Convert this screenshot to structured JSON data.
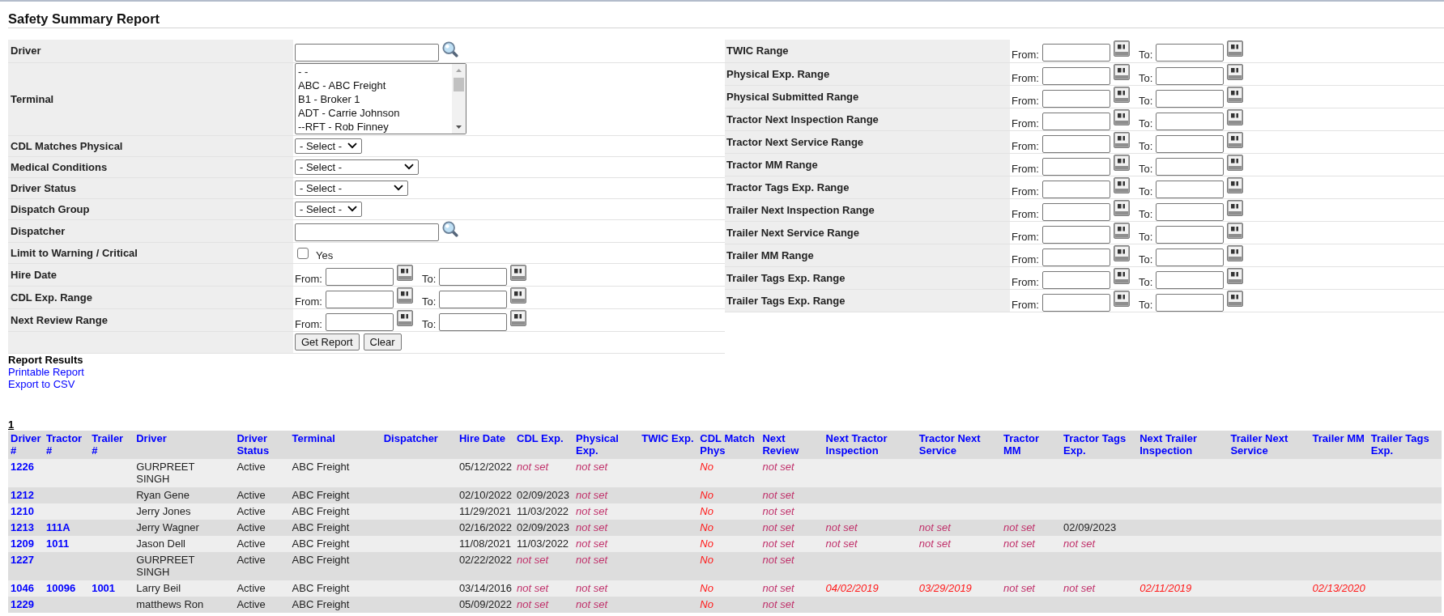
{
  "page": {
    "title": "Safety Summary Report"
  },
  "filters": [
    {
      "kind": "search",
      "label": "Driver"
    },
    {
      "kind": "listbox",
      "label": "Terminal",
      "options": [
        {
          "text": "- -",
          "selected": false
        },
        {
          "text": "ABC - ABC Freight",
          "selected": false
        },
        {
          "text": "B1 - Broker 1",
          "selected": false
        },
        {
          "text": "ADT - Carrie Johnson",
          "selected": false
        },
        {
          "text": "--RFT - Rob Finney",
          "selected": false
        }
      ]
    },
    {
      "kind": "select",
      "label": "CDL Matches Physical",
      "value": "- Select -"
    },
    {
      "kind": "select",
      "label": "Medical Conditions",
      "value": "- Select -"
    },
    {
      "kind": "select",
      "label": "Driver Status",
      "value": "- Select -"
    },
    {
      "kind": "select",
      "label": "Dispatch Group",
      "value": "- Select -"
    },
    {
      "kind": "search",
      "label": "Dispatcher"
    },
    {
      "kind": "checkbox",
      "label": "Limit to Warning / Critical",
      "option": "Yes",
      "checked": false
    },
    {
      "kind": "range",
      "label": "Hire Date",
      "from_label": "From:",
      "to_label": "To:"
    },
    {
      "kind": "range",
      "label": "CDL Exp. Range",
      "from_label": "From:",
      "to_label": "To:"
    },
    {
      "kind": "range",
      "label": "Next Review Range",
      "from_label": "From:",
      "to_label": "To:"
    },
    {
      "kind": "buttons",
      "buttons": [
        "Get Report",
        "Clear"
      ]
    }
  ],
  "range_filters": [
    {
      "label": "TWIC Range",
      "from_label": "From:",
      "to_label": "To:"
    },
    {
      "label": "Physical Exp. Range",
      "from_label": "From:",
      "to_label": "To:"
    },
    {
      "label": "Physical Submitted Range",
      "from_label": "From:",
      "to_label": "To:"
    },
    {
      "label": "Tractor Next Inspection Range",
      "from_label": "From:",
      "to_label": "To:"
    },
    {
      "label": "Tractor Next Service Range",
      "from_label": "From:",
      "to_label": "To:"
    },
    {
      "label": "Tractor MM Range",
      "from_label": "From:",
      "to_label": "To:"
    },
    {
      "label": "Tractor Tags Exp. Range",
      "from_label": "From:",
      "to_label": "To:"
    },
    {
      "label": "Trailer Next Inspection Range",
      "from_label": "From:",
      "to_label": "To:"
    },
    {
      "label": "Trailer Next Service Range",
      "from_label": "From:",
      "to_label": "To:"
    },
    {
      "label": "Trailer MM Range",
      "from_label": "From:",
      "to_label": "To:"
    },
    {
      "label": "Trailer Tags Exp. Range",
      "from_label": "From:",
      "to_label": "To:"
    },
    {
      "label": "Trailer Tags Exp. Range",
      "from_label": "From:",
      "to_label": "To:"
    }
  ],
  "report_results": {
    "heading": "Report Results",
    "links": [
      "Printable Report",
      "Export to CSV"
    ]
  },
  "page_links": [
    "1"
  ],
  "table": {
    "columns": [
      "Driver #",
      "Tractor #",
      "Trailer #",
      "Driver",
      "Driver Status",
      "Terminal",
      "Dispatcher",
      "Hire Date",
      "CDL Exp.",
      "Physical Exp.",
      "TWIC Exp.",
      "CDL Match Phys",
      "Next Review",
      "Next Tractor Inspection",
      "Tractor Next Service",
      "Tractor MM",
      "Tractor Tags Exp.",
      "Next Trailer Inspection",
      "Trailer Next Service",
      "Trailer MM",
      "Trailer Tags Exp."
    ],
    "rows": [
      {
        "cells": [
          {
            "text": "1226",
            "kind": "link"
          },
          null,
          null,
          {
            "text": "GURPREET SINGH",
            "kind": "text"
          },
          {
            "text": "Active",
            "kind": "text"
          },
          {
            "text": "ABC Freight",
            "kind": "text"
          },
          null,
          {
            "text": "05/12/2022",
            "kind": "text"
          },
          {
            "text": "not set",
            "kind": "unset"
          },
          {
            "text": "not set",
            "kind": "unset"
          },
          null,
          {
            "text": "No",
            "kind": "alert"
          },
          {
            "text": "not set",
            "kind": "unset"
          }
        ]
      },
      {
        "cells": [
          {
            "text": "1212",
            "kind": "link"
          },
          null,
          null,
          {
            "text": "Ryan Gene",
            "kind": "text"
          },
          {
            "text": "Active",
            "kind": "text"
          },
          {
            "text": "ABC Freight",
            "kind": "text"
          },
          null,
          {
            "text": "02/10/2022",
            "kind": "text"
          },
          {
            "text": "02/09/2023",
            "kind": "text"
          },
          {
            "text": "not set",
            "kind": "unset"
          },
          null,
          {
            "text": "No",
            "kind": "alert"
          },
          {
            "text": "not set",
            "kind": "unset"
          }
        ]
      },
      {
        "cells": [
          {
            "text": "1210",
            "kind": "link"
          },
          null,
          null,
          {
            "text": "Jerry Jones",
            "kind": "text"
          },
          {
            "text": "Active",
            "kind": "text"
          },
          {
            "text": "ABC Freight",
            "kind": "text"
          },
          null,
          {
            "text": "11/29/2021",
            "kind": "text"
          },
          {
            "text": "11/03/2022",
            "kind": "text"
          },
          {
            "text": "not set",
            "kind": "unset"
          },
          null,
          {
            "text": "No",
            "kind": "alert"
          },
          {
            "text": "not set",
            "kind": "unset"
          }
        ]
      },
      {
        "cells": [
          {
            "text": "1213",
            "kind": "link"
          },
          {
            "text": "111A",
            "kind": "link"
          },
          null,
          {
            "text": "Jerry Wagner",
            "kind": "text"
          },
          {
            "text": "Active",
            "kind": "text"
          },
          {
            "text": "ABC Freight",
            "kind": "text"
          },
          null,
          {
            "text": "02/16/2022",
            "kind": "text"
          },
          {
            "text": "02/09/2023",
            "kind": "text"
          },
          {
            "text": "not set",
            "kind": "unset"
          },
          null,
          {
            "text": "No",
            "kind": "alert"
          },
          {
            "text": "not set",
            "kind": "unset"
          },
          {
            "text": "not set",
            "kind": "unset"
          },
          {
            "text": "not set",
            "kind": "unset"
          },
          {
            "text": "not set",
            "kind": "unset"
          },
          {
            "text": "02/09/2023",
            "kind": "text"
          }
        ]
      },
      {
        "cells": [
          {
            "text": "1209",
            "kind": "link"
          },
          {
            "text": "1011",
            "kind": "link"
          },
          null,
          {
            "text": "Jason Dell",
            "kind": "text"
          },
          {
            "text": "Active",
            "kind": "text"
          },
          {
            "text": "ABC Freight",
            "kind": "text"
          },
          null,
          {
            "text": "11/08/2021",
            "kind": "text"
          },
          {
            "text": "11/03/2022",
            "kind": "text"
          },
          {
            "text": "not set",
            "kind": "unset"
          },
          null,
          {
            "text": "No",
            "kind": "alert"
          },
          {
            "text": "not set",
            "kind": "unset"
          },
          {
            "text": "not set",
            "kind": "unset"
          },
          {
            "text": "not set",
            "kind": "unset"
          },
          {
            "text": "not set",
            "kind": "unset"
          },
          {
            "text": "not set",
            "kind": "unset"
          }
        ]
      },
      {
        "cells": [
          {
            "text": "1227",
            "kind": "link"
          },
          null,
          null,
          {
            "text": "GURPREET SINGH",
            "kind": "text"
          },
          {
            "text": "Active",
            "kind": "text"
          },
          {
            "text": "ABC Freight",
            "kind": "text"
          },
          null,
          {
            "text": "02/22/2022",
            "kind": "text"
          },
          {
            "text": "not set",
            "kind": "unset"
          },
          {
            "text": "not set",
            "kind": "unset"
          },
          null,
          {
            "text": "No",
            "kind": "alert"
          },
          {
            "text": "not set",
            "kind": "unset"
          }
        ]
      },
      {
        "cells": [
          {
            "text": "1046",
            "kind": "link"
          },
          {
            "text": "10096",
            "kind": "link"
          },
          {
            "text": "1001",
            "kind": "link"
          },
          {
            "text": "Larry Beil",
            "kind": "text"
          },
          {
            "text": "Active",
            "kind": "text"
          },
          {
            "text": "ABC Freight",
            "kind": "text"
          },
          null,
          {
            "text": "03/14/2016",
            "kind": "text"
          },
          {
            "text": "not set",
            "kind": "unset"
          },
          {
            "text": "not set",
            "kind": "unset"
          },
          null,
          {
            "text": "No",
            "kind": "alert"
          },
          {
            "text": "not set",
            "kind": "unset"
          },
          {
            "text": "04/02/2019",
            "kind": "alert"
          },
          {
            "text": "03/29/2019",
            "kind": "alert"
          },
          {
            "text": "not set",
            "kind": "unset"
          },
          {
            "text": "not set",
            "kind": "unset"
          },
          {
            "text": "02/11/2019",
            "kind": "alert"
          },
          null,
          {
            "text": "02/13/2020",
            "kind": "alert"
          }
        ]
      },
      {
        "cells": [
          {
            "text": "1229",
            "kind": "link"
          },
          null,
          null,
          {
            "text": "matthews Ron",
            "kind": "text"
          },
          {
            "text": "Active",
            "kind": "text"
          },
          {
            "text": "ABC Freight",
            "kind": "text"
          },
          null,
          {
            "text": "05/09/2022",
            "kind": "text"
          },
          {
            "text": "not set",
            "kind": "unset"
          },
          {
            "text": "not set",
            "kind": "unset"
          },
          null,
          {
            "text": "No",
            "kind": "alert"
          },
          {
            "text": "not set",
            "kind": "unset"
          }
        ]
      }
    ]
  }
}
